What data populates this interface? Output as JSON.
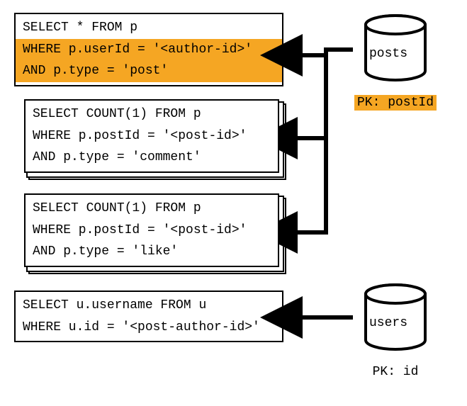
{
  "queries": {
    "q1": {
      "line1": "SELECT * FROM p",
      "line2": "WHERE p.userId = '<author-id>'",
      "line3": "AND p.type = 'post'"
    },
    "q2": {
      "line1": "SELECT COUNT(1) FROM p",
      "line2": "WHERE p.postId = '<post-id>'",
      "line3": "AND p.type = 'comment'"
    },
    "q3": {
      "line1": "SELECT COUNT(1) FROM p",
      "line2": "WHERE p.postId = '<post-id>'",
      "line3": "AND p.type = 'like'"
    },
    "q4": {
      "line1": "SELECT u.username FROM u",
      "line2": "WHERE u.id = '<post-author-id>'"
    }
  },
  "databases": {
    "posts": {
      "name": "posts",
      "pk": "PK: postId"
    },
    "users": {
      "name": "users",
      "pk": "PK: id"
    }
  }
}
